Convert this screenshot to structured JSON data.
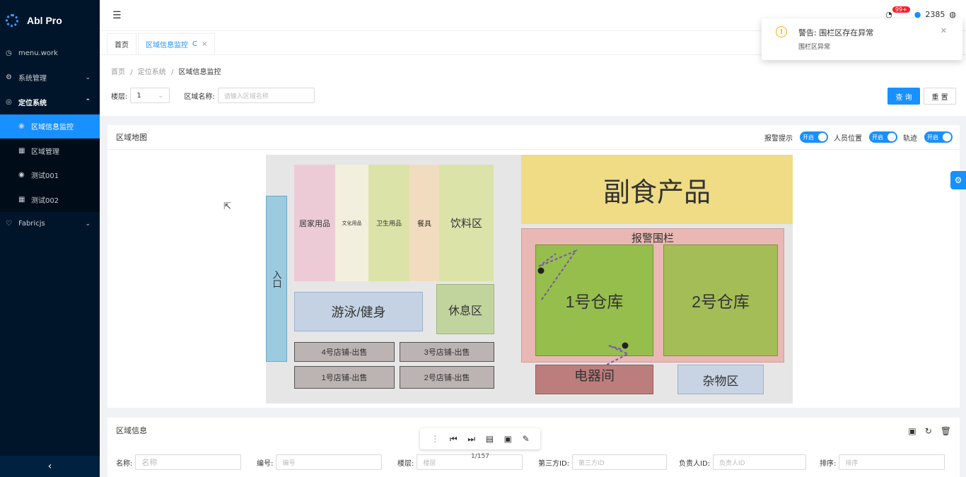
{
  "app": {
    "title": "Abl Pro"
  },
  "sidebar": {
    "items": [
      {
        "label": "menu.work",
        "icon": "◷"
      },
      {
        "label": "系统管理",
        "icon": "⚙",
        "arrow": "⌄"
      },
      {
        "label": "定位系统",
        "icon": "◎",
        "arrow": "⌃"
      },
      {
        "label": "Fabricjs",
        "icon": "♡",
        "arrow": "⌄"
      }
    ],
    "sub_items": [
      {
        "label": "区域信息监控",
        "icon": "◉"
      },
      {
        "label": "区域管理",
        "icon": "▦"
      },
      {
        "label": "测试001",
        "icon": "◉"
      },
      {
        "label": "测试002",
        "icon": "▦"
      }
    ],
    "collapse_icon": "‹"
  },
  "header": {
    "menu_icon": "☰",
    "badge": "99+",
    "user_partial": "2385"
  },
  "tabs": [
    {
      "label": "首页"
    },
    {
      "label": "区域信息监控",
      "refresh": "C",
      "close": "×"
    }
  ],
  "breadcrumb": {
    "home": "首页",
    "sep": "/",
    "level2": "定位系统",
    "current": "区域信息监控"
  },
  "query": {
    "floor_label": "楼层:",
    "floor_value": "1",
    "area_label": "区域名称:",
    "area_placeholder": "请输入区域名称",
    "search_btn": "查 询",
    "reset_btn": "重 置"
  },
  "map_card": {
    "title": "区域地图",
    "switches": [
      {
        "label": "报警提示",
        "state": "开启"
      },
      {
        "label": "人员位置",
        "state": "开启"
      },
      {
        "label": "轨迹",
        "state": "开启"
      }
    ]
  },
  "map": {
    "entrance": "入口",
    "home_goods": "居家用品",
    "stationery": "文化用品",
    "hygiene": "卫生用品",
    "tableware": "餐具",
    "drinks": "饮料区",
    "swim": "游泳/健身",
    "rest": "休息区",
    "shop4": "4号店铺-出售",
    "shop3": "3号店铺-出售",
    "shop1": "1号店铺-出售",
    "shop2": "2号店铺-出售",
    "food": "副食产品",
    "fence": "报警围栏",
    "wh1": "1号仓库",
    "wh2": "2号仓库",
    "electric": "电器间",
    "misc": "杂物区"
  },
  "info_card": {
    "title": "区域信息",
    "fields": [
      {
        "label": "名称:",
        "placeholder": "名称"
      },
      {
        "label": "编号:",
        "placeholder": "编号"
      },
      {
        "label": "楼层:",
        "placeholder": "楼层"
      },
      {
        "label": "第三方ID:",
        "placeholder": "第三方ID"
      },
      {
        "label": "负责人ID:",
        "placeholder": "负责人ID"
      },
      {
        "label": "排序:",
        "placeholder": "排序"
      }
    ]
  },
  "pager": {
    "text": "1/157"
  },
  "notification": {
    "title": "警告: 围栏区存在异常",
    "desc": "围栏区异常",
    "icon": "!"
  }
}
